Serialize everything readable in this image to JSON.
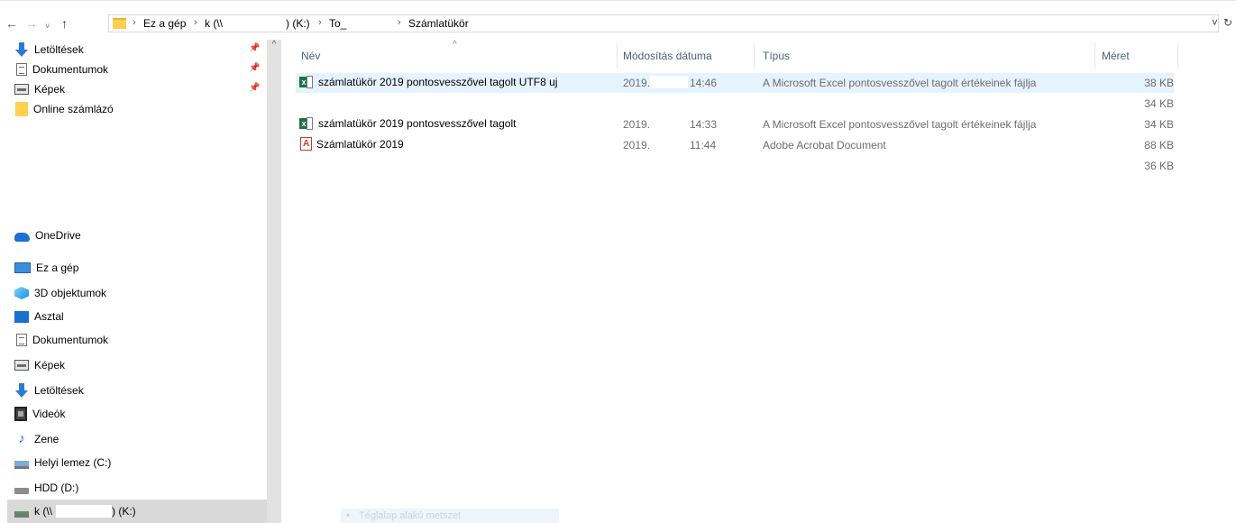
{
  "address": {
    "crumbs": [
      "Ez a gép",
      "k (\\\\",
      ") (K:)",
      "To_",
      "Számlatükör"
    ]
  },
  "sidebar": {
    "quick_access": [
      {
        "label": "Letöltések",
        "icon": "download-icon",
        "pinned": true
      },
      {
        "label": "Dokumentumok",
        "icon": "document-icon",
        "pinned": true
      },
      {
        "label": "Képek",
        "icon": "pictures-icon",
        "pinned": true
      },
      {
        "label": "Online számlázó",
        "icon": "folder-icon",
        "pinned": false
      }
    ],
    "onedrive": "OneDrive",
    "this_pc": "Ez a gép",
    "pc_items": [
      {
        "label": "3D objektumok",
        "icon": "3d-objects-icon"
      },
      {
        "label": "Asztal",
        "icon": "desktop-icon"
      },
      {
        "label": "Dokumentumok",
        "icon": "document-icon"
      },
      {
        "label": "Képek",
        "icon": "pictures-icon"
      },
      {
        "label": "Letöltések",
        "icon": "download-icon"
      },
      {
        "label": "Videók",
        "icon": "videos-icon"
      },
      {
        "label": "Zene",
        "icon": "music-icon"
      },
      {
        "label": "Helyi lemez (C:)",
        "icon": "local-disk-icon"
      },
      {
        "label": "HDD (D:)",
        "icon": "hdd-icon"
      }
    ],
    "network_drive": {
      "prefix": "k (\\\\",
      "suffix": ") (K:)"
    }
  },
  "columns": {
    "name": "Név",
    "modified": "Módosítás dátuma",
    "type": "Típus",
    "size": "Méret"
  },
  "files": [
    {
      "name": "számlatükör 2019 pontosvesszővel tagolt UTF8 uj",
      "date": "2019.",
      "time": "14:46",
      "type": "A Microsoft Excel pontosvesszővel tagolt értékeinek fájlja",
      "size": "38 KB",
      "icon": "excel-csv-icon",
      "selected": true
    },
    {
      "name": "",
      "date": "",
      "time": "",
      "type": "",
      "size": "34 KB",
      "icon": "",
      "selected": false
    },
    {
      "name": "számlatükör 2019 pontosvesszővel tagolt",
      "date": "2019.",
      "time": "14:33",
      "type": "A Microsoft Excel pontosvesszővel tagolt értékeinek fájlja",
      "size": "34 KB",
      "icon": "excel-csv-icon",
      "selected": false
    },
    {
      "name": "Számlatükör 2019",
      "date": "2019.",
      "time": "11:44",
      "type": "Adobe Acrobat Document",
      "size": "88 KB",
      "icon": "pdf-icon",
      "selected": false
    },
    {
      "name": "",
      "date": "",
      "time": "",
      "type": "",
      "size": "36 KB",
      "icon": "",
      "selected": false
    }
  ],
  "tooltip": "Téglalap alakú metszet"
}
